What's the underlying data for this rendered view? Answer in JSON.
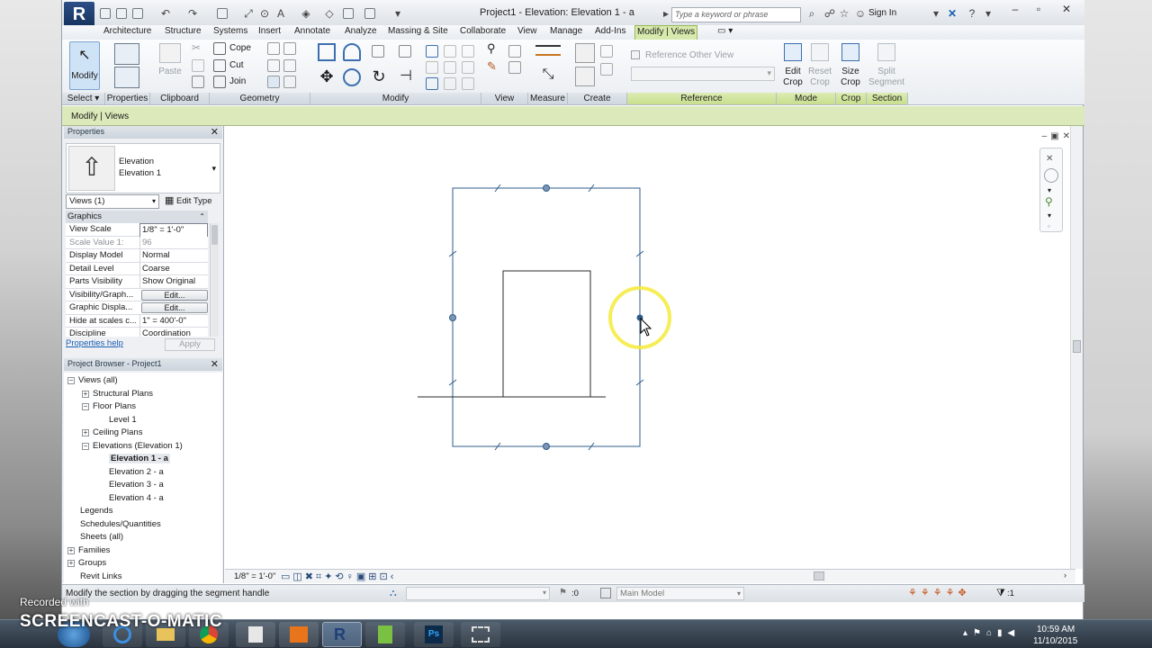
{
  "window": {
    "title": "Project1 - Elevation: Elevation 1 - a",
    "search_placeholder": "Type a keyword or phrase",
    "sign_in": "Sign In"
  },
  "ribbon": {
    "tabs": [
      "Architecture",
      "Structure",
      "Systems",
      "Insert",
      "Annotate",
      "Analyze",
      "Massing & Site",
      "Collaborate",
      "View",
      "Manage",
      "Add-Ins",
      "Modify | Views"
    ],
    "active_tab": "Modify | Views",
    "panels": {
      "select": "Select ▾",
      "properties": "Properties",
      "clipboard": "Clipboard",
      "geometry": "Geometry",
      "modify": "Modify",
      "view": "View",
      "measure": "Measure",
      "create": "Create",
      "reference": "Reference",
      "mode": "Mode",
      "crop": "Crop",
      "section": "Section"
    },
    "buttons": {
      "modify": "Modify",
      "paste": "Paste",
      "cope": "Cope",
      "cut": "Cut",
      "join": "Join",
      "reference_other_view": "Reference Other View",
      "edit_crop_1": "Edit",
      "edit_crop_2": "Crop",
      "reset_crop_1": "Reset",
      "reset_crop_2": "Crop",
      "size_crop_1": "Size",
      "size_crop_2": "Crop",
      "split_segment_1": "Split",
      "split_segment_2": "Segment"
    }
  },
  "options_bar": {
    "context": "Modify | Views"
  },
  "properties_panel": {
    "title": "Properties",
    "type_name": "Elevation",
    "type_subname": "Elevation 1",
    "view_selector": "Views (1)",
    "edit_type": "Edit Type",
    "group": "Graphics",
    "rows": [
      {
        "name": "View Scale",
        "value": "1/8\" = 1'-0\""
      },
      {
        "name": "Scale Value    1:",
        "value": "96"
      },
      {
        "name": "Display Model",
        "value": "Normal"
      },
      {
        "name": "Detail Level",
        "value": "Coarse"
      },
      {
        "name": "Parts Visibility",
        "value": "Show Original"
      },
      {
        "name": "Visibility/Graph...",
        "value": "Edit..."
      },
      {
        "name": "Graphic Displa...",
        "value": "Edit..."
      },
      {
        "name": "Hide at scales c...",
        "value": "1\" = 400'-0\""
      },
      {
        "name": "Discipline",
        "value": "Coordination"
      }
    ],
    "help_link": "Properties help",
    "apply": "Apply"
  },
  "project_browser": {
    "title": "Project Browser - Project1",
    "items": [
      {
        "label": "Views (all)",
        "level": 0,
        "toggle": "−"
      },
      {
        "label": "Structural Plans",
        "level": 1,
        "toggle": "+"
      },
      {
        "label": "Floor Plans",
        "level": 1,
        "toggle": "−"
      },
      {
        "label": "Level 1",
        "level": 2,
        "toggle": ""
      },
      {
        "label": "Ceiling Plans",
        "level": 1,
        "toggle": "+"
      },
      {
        "label": "Elevations (Elevation 1)",
        "level": 1,
        "toggle": "−"
      },
      {
        "label": "Elevation 1 - a",
        "level": 2,
        "toggle": "",
        "selected": true
      },
      {
        "label": "Elevation 2 - a",
        "level": 2,
        "toggle": ""
      },
      {
        "label": "Elevation 3 - a",
        "level": 2,
        "toggle": ""
      },
      {
        "label": "Elevation 4 - a",
        "level": 2,
        "toggle": ""
      },
      {
        "label": "Legends",
        "level": 0,
        "toggle": ""
      },
      {
        "label": "Schedules/Quantities",
        "level": 0,
        "toggle": ""
      },
      {
        "label": "Sheets (all)",
        "level": 0,
        "toggle": ""
      },
      {
        "label": "Families",
        "level": 0,
        "toggle": "+"
      },
      {
        "label": "Groups",
        "level": 0,
        "toggle": "+"
      },
      {
        "label": "Revit Links",
        "level": 0,
        "toggle": ""
      }
    ]
  },
  "view_control_bar": {
    "scale": "1/8\" = 1'-0\""
  },
  "status_bar": {
    "message": "Modify the section by dragging the segment handle",
    "count": ":0",
    "model": "Main Model",
    "filter_count": ":1"
  },
  "taskbar": {
    "time": "10:59 AM",
    "date": "11/10/2015"
  },
  "watermark": {
    "recorded": "Recorded with",
    "brand": "SCREENCAST-O-MATIC"
  },
  "colors": {
    "ribbon_context": "#d7e9ac",
    "crop_line": "#2e5c8a",
    "cursor_highlight": "#f4ea3a",
    "selection": "#cfe3f7"
  }
}
